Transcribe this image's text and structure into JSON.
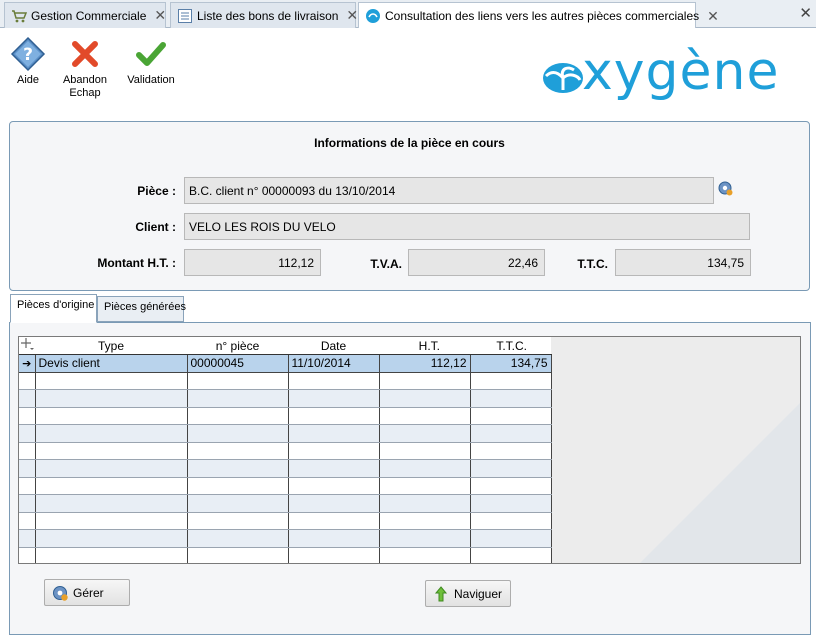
{
  "tabs": [
    {
      "label": "Gestion Commerciale",
      "icon": "cart-icon"
    },
    {
      "label": "Liste des bons de livraison",
      "icon": "list-icon"
    },
    {
      "label": "Consultation des liens vers les autres pièces commerciales",
      "icon": "oxygene-icon",
      "active": true
    }
  ],
  "toolbar": {
    "help_label": "Aide",
    "cancel_label": "Abandon",
    "cancel_shortcut": "Echap",
    "validate_label": "Validation"
  },
  "logo": {
    "text": "xygène",
    "color": "#1f9fd9"
  },
  "info": {
    "title": "Informations de la pièce en cours",
    "piece_label": "Pièce :",
    "piece_value": "B.C. client n° 00000093 du 13/10/2014",
    "client_label": "Client :",
    "client_value": "VELO LES ROIS DU VELO",
    "ht_label": "Montant H.T. :",
    "ht_value": "112,12",
    "tva_label": "T.V.A.",
    "tva_value": "22,46",
    "ttc_label": "T.T.C.",
    "ttc_value": "134,75"
  },
  "subtabs": {
    "origin": "Pièces d'origine",
    "generated": "Pièces générées"
  },
  "grid": {
    "columns": [
      "Type",
      "n° pièce",
      "Date",
      "H.T.",
      "T.T.C."
    ],
    "rows": [
      {
        "type": "Devis client",
        "numero": "00000045",
        "date": "11/10/2014",
        "ht": "112,12",
        "ttc": "134,75"
      }
    ]
  },
  "buttons": {
    "manage_label": "Gérer",
    "navigate_label": "Naviguer"
  },
  "colors": {
    "accent": "#1f9fd9",
    "selection": "#b9d3ec",
    "border": "#7a9ab5"
  }
}
